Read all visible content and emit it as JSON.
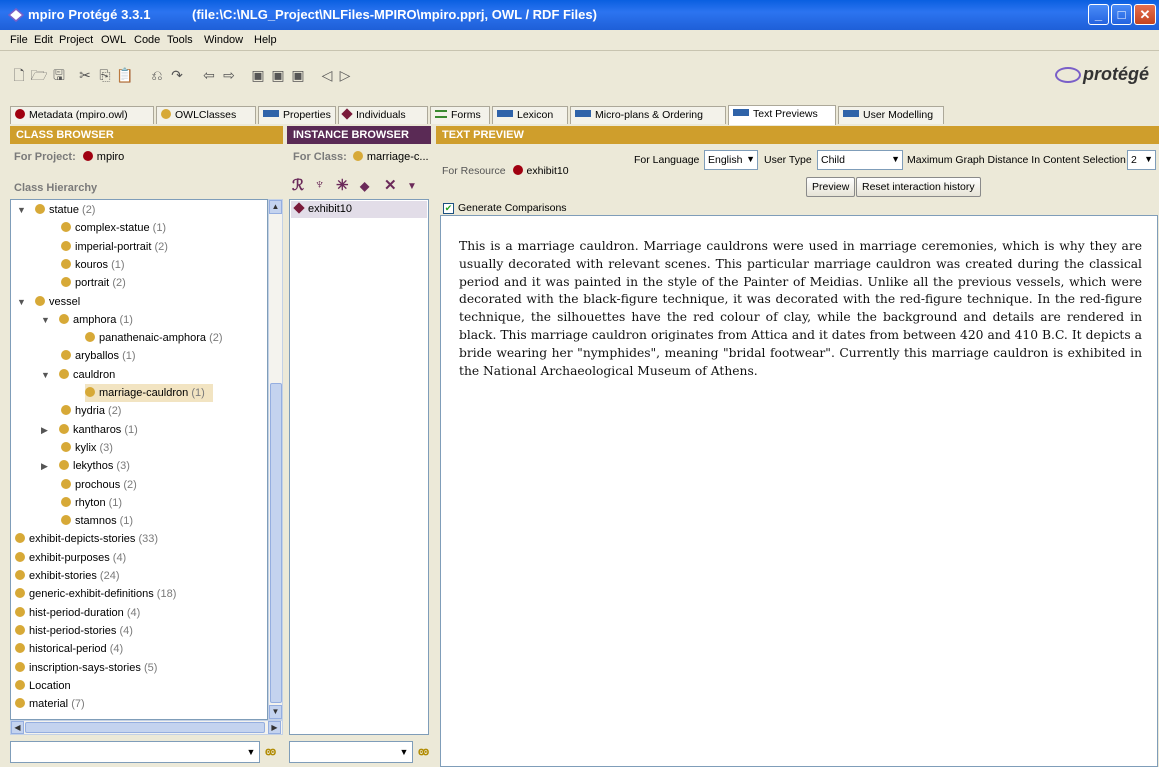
{
  "window": {
    "title_app": "mpiro  Protégé 3.3.1",
    "title_path": "(file:\\C:\\NLG_Project\\NLFiles-MPIRO\\mpiro.pprj, OWL / RDF Files)"
  },
  "menu": [
    "File",
    "Edit",
    "Project",
    "OWL",
    "Code",
    "Tools",
    "Window",
    "Help"
  ],
  "logo_text": "protégé",
  "tabs": [
    {
      "label": "Metadata (mpiro.owl)",
      "icon": "red-circle-icon"
    },
    {
      "label": "OWLClasses",
      "icon": "gold-circle-icon"
    },
    {
      "label": "Properties",
      "icon": "blue-bar-icon"
    },
    {
      "label": "Individuals",
      "icon": "purple-diamond-icon"
    },
    {
      "label": "Forms",
      "icon": "form-lines-icon"
    },
    {
      "label": "Lexicon",
      "icon": "blue-bar-icon"
    },
    {
      "label": "Micro-plans & Ordering",
      "icon": "blue-bar-icon"
    },
    {
      "label": "Text Previews",
      "icon": "blue-bar-icon",
      "active": true
    },
    {
      "label": "User Modelling",
      "icon": "blue-bar-icon"
    }
  ],
  "class_browser": {
    "header": "CLASS BROWSER",
    "for_project_label": "For Project:",
    "project": "mpiro",
    "hierarchy_label": "Class Hierarchy",
    "tree": [
      {
        "name": "statue",
        "count": "(2)",
        "expander": "▼"
      },
      {
        "name": "complex-statue",
        "count": "(1)"
      },
      {
        "name": "imperial-portrait",
        "count": "(2)"
      },
      {
        "name": "kouros",
        "count": "(1)"
      },
      {
        "name": "portrait",
        "count": "(2)"
      },
      {
        "name": "vessel",
        "count": "",
        "expander": "▼"
      },
      {
        "name": "amphora",
        "count": "(1)",
        "expander": "▼"
      },
      {
        "name": "panathenaic-amphora",
        "count": "(2)"
      },
      {
        "name": "aryballos",
        "count": "(1)"
      },
      {
        "name": "cauldron",
        "count": "",
        "expander": "▼"
      },
      {
        "name": "marriage-cauldron",
        "count": "(1)",
        "selected": true
      },
      {
        "name": "hydria",
        "count": "(2)"
      },
      {
        "name": "kantharos",
        "count": "(1)",
        "expander": "▶"
      },
      {
        "name": "kylix",
        "count": "(3)"
      },
      {
        "name": "lekythos",
        "count": "(3)",
        "expander": "▶"
      },
      {
        "name": "prochous",
        "count": "(2)"
      },
      {
        "name": "rhyton",
        "count": "(1)"
      },
      {
        "name": "stamnos",
        "count": "(1)"
      },
      {
        "name": "exhibit-depicts-stories",
        "count": "(33)"
      },
      {
        "name": "exhibit-purposes",
        "count": "(4)"
      },
      {
        "name": "exhibit-stories",
        "count": "(24)"
      },
      {
        "name": "generic-exhibit-definitions",
        "count": "(18)"
      },
      {
        "name": "hist-period-duration",
        "count": "(4)"
      },
      {
        "name": "hist-period-stories",
        "count": "(4)"
      },
      {
        "name": "historical-period",
        "count": "(4)"
      },
      {
        "name": "inscription-says-stories",
        "count": "(5)"
      },
      {
        "name": "Location",
        "count": ""
      },
      {
        "name": "material",
        "count": "(7)"
      }
    ]
  },
  "instance_browser": {
    "header": "INSTANCE BROWSER",
    "for_class_label": "For Class:",
    "class": "marriage-c...",
    "instances": [
      "exhibit10"
    ]
  },
  "text_preview": {
    "header": "TEXT PREVIEW",
    "for_resource_label": "For Resource",
    "resource": "exhibit10",
    "language_label": "For Language",
    "language": "English",
    "user_type_label": "User Type",
    "user_type": "Child",
    "max_distance_label": "Maximum Graph Distance In Content Selection",
    "max_distance": "2",
    "preview_button": "Preview",
    "reset_button": "Reset interaction history",
    "generate_comparisons": "Generate Comparisons",
    "text": "This is a marriage cauldron. Marriage cauldrons were used in marriage ceremonies, which is why they are usually decorated with relevant scenes. This particular marriage cauldron was created during the classical period and it was painted in the style of the Painter of Meidias. Unlike all the previous vessels, which were decorated with the black-figure technique, it was decorated with the red-figure technique. In the red-figure technique, the silhouettes have the red colour of clay, while the background and details are rendered in black. This marriage cauldron originates from Attica and it dates from between 420 and 410 B.C. It depicts a bride wearing her \"nymphides\", meaning \"bridal footwear\". Currently this marriage cauldron is exhibited in the National Archaeological Museum of Athens."
  }
}
